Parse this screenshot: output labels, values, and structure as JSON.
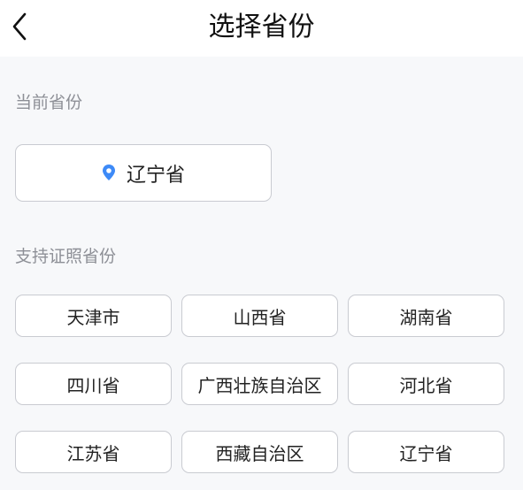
{
  "header": {
    "title": "选择省份",
    "back_icon": "chevron-left-icon"
  },
  "current_section": {
    "label": "当前省份",
    "value": "辽宁省",
    "icon": "location-pin-icon",
    "icon_color": "#3d8af7"
  },
  "supported_section": {
    "label": "支持证照省份",
    "provinces": [
      {
        "label": "天津市"
      },
      {
        "label": "山西省"
      },
      {
        "label": "湖南省"
      },
      {
        "label": "四川省"
      },
      {
        "label": "广西壮族自治区"
      },
      {
        "label": "河北省"
      },
      {
        "label": "江苏省"
      },
      {
        "label": "西藏自治区"
      },
      {
        "label": "辽宁省"
      }
    ]
  }
}
